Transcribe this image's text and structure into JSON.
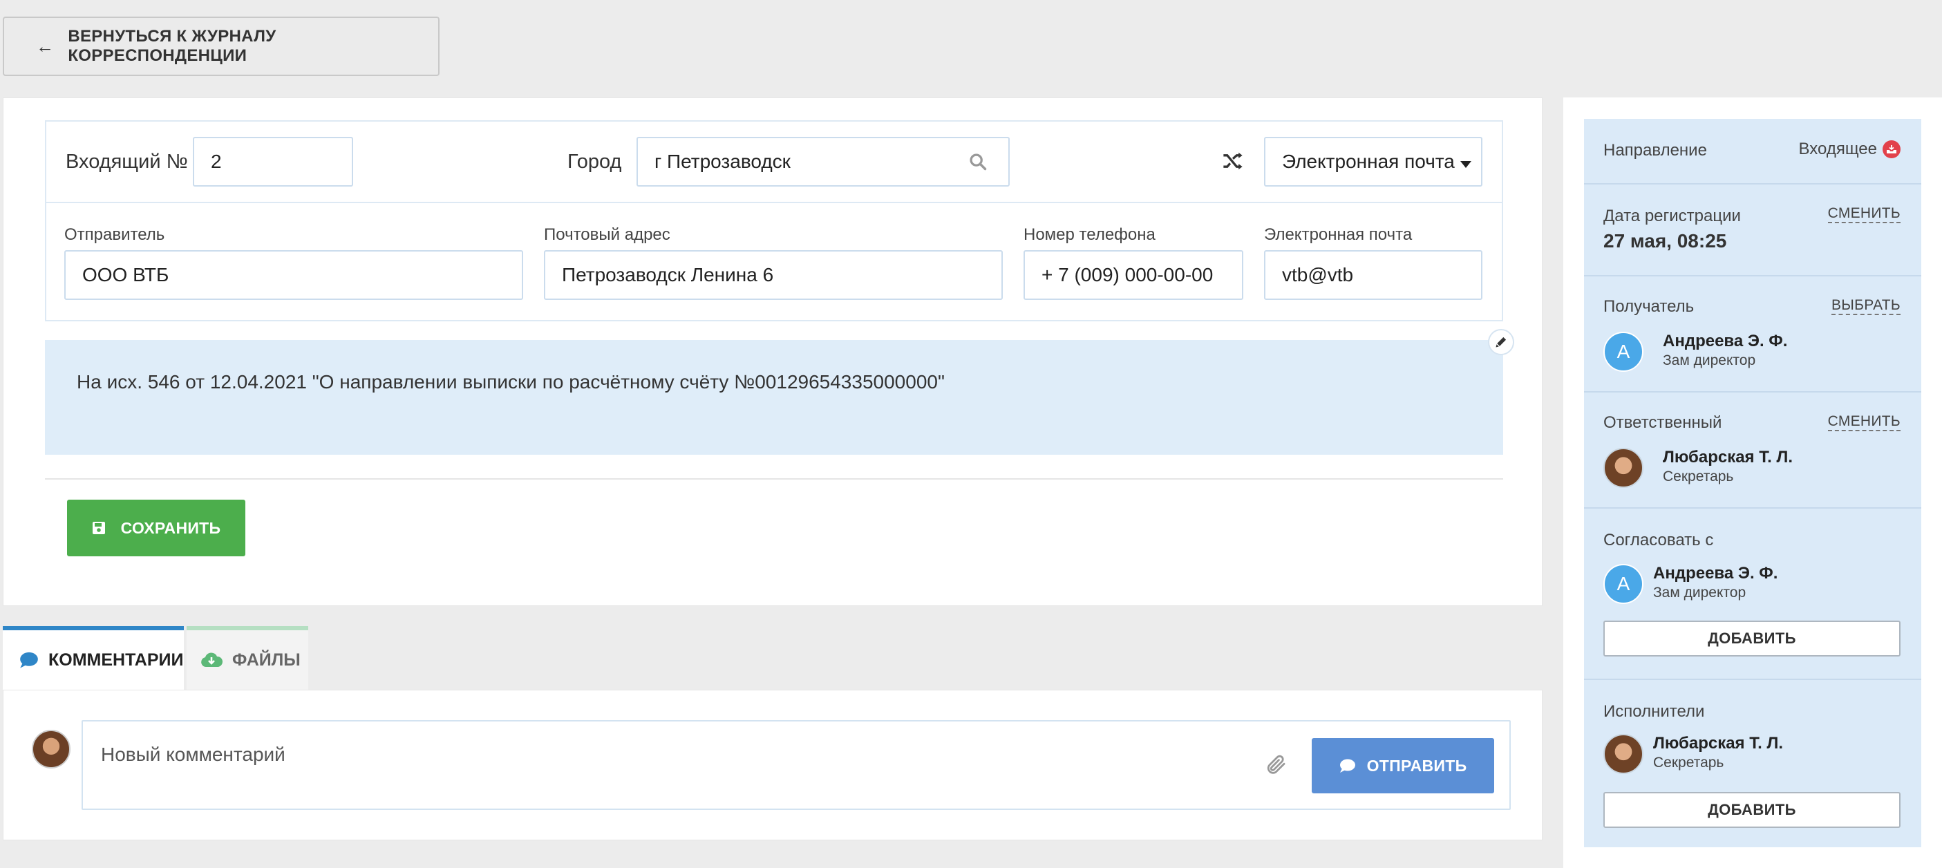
{
  "back_button": {
    "label": "ВЕРНУТЬСЯ К ЖУРНАЛУ КОРРЕСПОНДЕНЦИИ"
  },
  "form": {
    "number_label": "Входящий №",
    "number_value": "2",
    "city_label": "Город",
    "city_value": "г Петрозаводск",
    "channel_value": "Электронная почта",
    "sender_label": "Отправитель",
    "sender_value": "ООО ВТБ",
    "address_label": "Почтовый адрес",
    "address_value": "Петрозаводск Ленина 6",
    "phone_label": "Номер телефона",
    "phone_value": "+ 7 (009) 000-00-00",
    "email_label": "Электронная почта",
    "email_value": "vtb@vtb",
    "subject": "На исх. 546 от 12.04.2021 \"О направлении выписки по расчётному счёту №00129654335000000\"",
    "save_label": "СОХРАНИТЬ"
  },
  "tabs": [
    {
      "label": "КОММЕНТАРИИ",
      "active": true
    },
    {
      "label": "ФАЙЛЫ",
      "active": false
    }
  ],
  "comment": {
    "placeholder": "Новый комментарий",
    "send_label": "ОТПРАВИТЬ"
  },
  "sidebar": {
    "direction_label": "Направление",
    "direction_value": "Входящее",
    "reg_date_label": "Дата регистрации",
    "reg_date_action": "СМЕНИТЬ",
    "reg_date_value": "27 мая, 08:25",
    "recipient_label": "Получатель",
    "recipient_action": "ВЫБРАТЬ",
    "recipient": {
      "initial": "А",
      "name": "Андреева Э. Ф.",
      "role": "Зам директор"
    },
    "responsible_label": "Ответственный",
    "responsible_action": "СМЕНИТЬ",
    "responsible": {
      "name": "Любарская Т. Л.",
      "role": "Секретарь"
    },
    "approve_label": "Согласовать с",
    "approver": {
      "initial": "А",
      "name": "Андреева Э. Ф.",
      "role": "Зам директор"
    },
    "add_label": "ДОБАВИТЬ",
    "executors_label": "Исполнители",
    "executor": {
      "name": "Любарская Т. Л.",
      "role": "Секретарь"
    }
  },
  "colors": {
    "save": "#4cae4c",
    "send": "#5b8fd6",
    "tab_active": "#2f86c7",
    "sidebar_bg": "#dbeaf8",
    "badge": "#e2414b"
  },
  "icons": [
    "arrow-left-icon",
    "search-icon",
    "shuffle-icon",
    "caret-down-icon",
    "pencil-icon",
    "floppy-icon",
    "comment-icon",
    "cloud-download-icon",
    "paperclip-icon",
    "inbox-icon"
  ]
}
